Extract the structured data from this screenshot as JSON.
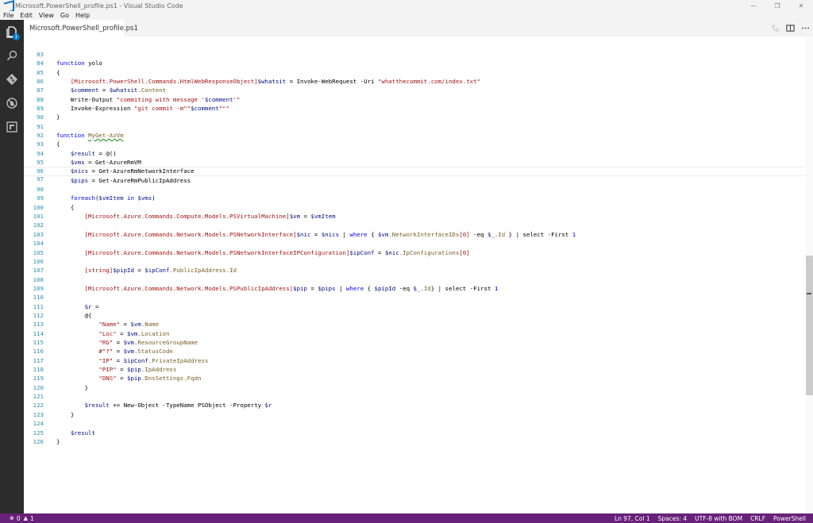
{
  "window": {
    "title": "Microsoft.PowerShell_profile.ps1 - Visual Studio Code",
    "minimize": "—",
    "maximize": "❐",
    "close": "✕"
  },
  "menu": [
    {
      "label": "File"
    },
    {
      "label": "Edit"
    },
    {
      "label": "View"
    },
    {
      "label": "Go"
    },
    {
      "label": "Help"
    }
  ],
  "activity": {
    "explorer_badge": "1"
  },
  "tab": {
    "label": "Microsoft.PowerShell_profile.ps1"
  },
  "editor": {
    "lines": [
      {
        "n": "83"
      },
      {
        "n": "84"
      },
      {
        "n": "85"
      },
      {
        "n": "86"
      },
      {
        "n": "87"
      },
      {
        "n": "88"
      },
      {
        "n": "89"
      },
      {
        "n": "90"
      },
      {
        "n": "91"
      },
      {
        "n": "92"
      },
      {
        "n": "93"
      },
      {
        "n": "94"
      },
      {
        "n": "95"
      },
      {
        "n": "96"
      },
      {
        "n": "97"
      },
      {
        "n": "98"
      },
      {
        "n": "99"
      },
      {
        "n": "100"
      },
      {
        "n": "101"
      },
      {
        "n": "102"
      },
      {
        "n": "103"
      },
      {
        "n": "104"
      },
      {
        "n": "105"
      },
      {
        "n": "106"
      },
      {
        "n": "107"
      },
      {
        "n": "108"
      },
      {
        "n": "109"
      },
      {
        "n": "110"
      },
      {
        "n": "111"
      },
      {
        "n": "112"
      },
      {
        "n": "113"
      },
      {
        "n": "114"
      },
      {
        "n": "115"
      },
      {
        "n": "116"
      },
      {
        "n": "117"
      },
      {
        "n": "118"
      },
      {
        "n": "119"
      },
      {
        "n": "120"
      },
      {
        "n": "121"
      },
      {
        "n": "122"
      },
      {
        "n": "123"
      },
      {
        "n": "124"
      },
      {
        "n": "125"
      },
      {
        "n": "126"
      }
    ],
    "tokens": {
      "function": "function",
      "yolo": "yolo",
      "open_brace": "{",
      "close_brace": "}",
      "t85_type": "[Microsoft.PowerShell.Commands.HtmlWebResponseObject]",
      "t85_var": "$whatsit",
      "t85_mid": " = Invoke-WebRequest -Uri ",
      "t85_str": "\"whatthecommit.com/index.txt\"",
      "t86_var": "$comment",
      "t86_eq": " = ",
      "t86_var2": "$whatsit",
      "t86_prop": ".Content",
      "t87_cmd": "Write-Output ",
      "t87_str1": "\"commiting with message '",
      "t87_var": "$comment",
      "t87_str2": "'\"",
      "t88_cmd": "Invoke-Expression ",
      "t88_str1": "\"git commit -m\"\"",
      "t88_var": "$comment",
      "t88_str2": "\"\"\"",
      "myget": "MyGet-AzVm",
      "t93_var": "$result",
      "t93_rest": " = @()",
      "t94_var": "$vms",
      "t94_rest": " = Get-AzureRmVM",
      "t95_var": "$nics",
      "t95_rest": " = Get-AzureRmNetworkInterface",
      "t96_var": "$pips",
      "t96_rest": " = Get-AzureRmPublicIpAddress",
      "foreach": "foreach",
      "t98_open": "(",
      "t98_var": "$vmItem",
      "in": " in ",
      "t98_var2": "$vms",
      "t98_close": ")",
      "t100_type": "[Microsoft.Azure.Commands.Compute.Models.PSVirtualMachine]",
      "t100_var": "$vm",
      "t100_eq": " = ",
      "t100_var2": "$vmItem",
      "t102_type": "[Microsoft.Azure.Commands.Network.Models.PSNetworkInterface]",
      "t102_var": "$nic",
      "t102_eq": " = ",
      "t102_var2": "$nics",
      "pipe": " | ",
      "where": "where",
      "t102_b1": " { ",
      "t102_var3": "$vm",
      "t102_prop": ".NetworkInterfaceIDs",
      "t102_idx": "[0]",
      "t102_eq2": " -eq ",
      "t102_var4": "$_",
      "t102_prop2": ".Id",
      "t102_end": " } ",
      "t102_sel": " select -First ",
      "one": "1",
      "t104_type": "[Microsoft.Azure.Commands.Network.Models.PSNetworkInterfaceIPConfiguration]",
      "t104_var": "$ipConf",
      "t104_eq": " = ",
      "t104_var2": "$nic",
      "t104_prop": ".IpConfigurations",
      "t104_idx": "[0]",
      "t106_type": "[string]",
      "t106_var": "$pipId",
      "t106_eq": " = ",
      "t106_var2": "$ipConf",
      "t106_prop": ".PublicIpAddress.Id",
      "t108_type": "[Microsoft.Azure.Commands.Network.Models.PSPublicIpAddress]",
      "t108_var": "$pip",
      "t108_eq": " = ",
      "t108_var2": "$pips",
      "t108_b1": " { ",
      "t108_var3": "$pipId",
      "t108_eq2": " -eq ",
      "t108_var4": "$_",
      "t108_prop": ".Id",
      "t108_end": "} ",
      "t108_sel": " select -First ",
      "t110_var": "$r",
      "t110_rest": " =",
      "t111": "@{",
      "k_name": "\"Name\"",
      "v_name_var": "$vm",
      "v_name_prop": ".Name",
      "k_loc": "\"Loc\"",
      "v_loc_var": "$vm",
      "v_loc_prop": ".Location",
      "k_rg": "\"RG\"",
      "v_rg_var": "$vm",
      "v_rg_prop": ".ResourceGroupName",
      "k_q": "#\"?\"",
      "v_q_var": "$vm",
      "v_q_prop": ".StatusCode",
      "k_ip": "\"IP\"",
      "v_ip_var": "$ipConf",
      "v_ip_prop": ".PrivateIpAddress",
      "k_pip": "\"PIP\"",
      "v_pip_var": "$pip",
      "v_pip_prop": ".IpAddress",
      "k_dns": "\"DNS\"",
      "v_dns_var": "$pip",
      "v_dns_prop": ".DnsSettings.Fqdn",
      "assign": " = ",
      "t121_var": "$result",
      "t121_mid": " += New-Object -TypeName PSObject -Property ",
      "t121_var2": "$r",
      "t124_var": "$result"
    }
  },
  "status": {
    "errors": "0",
    "warnings": "1",
    "position": "Ln 97, Col 1",
    "spaces": "Spaces: 4",
    "encoding": "UTF-8 with BOM",
    "eol": "CRLF",
    "language": "PowerShell"
  },
  "colors": {
    "statusbar": "#68217a",
    "activitybar": "#2c2c2c",
    "keyword": "#0000ff",
    "string": "#a31515",
    "variable": "#001080",
    "line_number": "#2b91af"
  }
}
